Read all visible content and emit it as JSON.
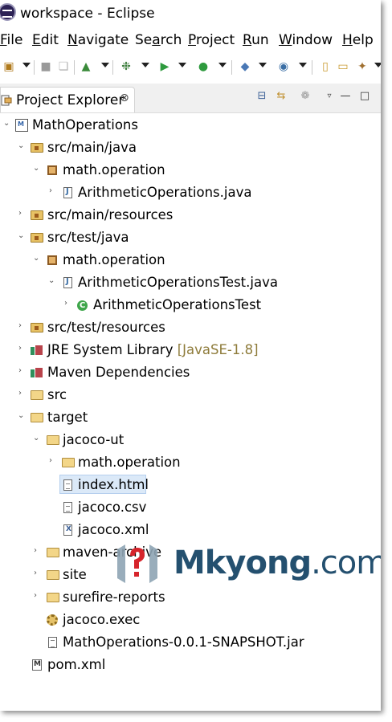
{
  "window": {
    "title": "workspace - Eclipse"
  },
  "menubar": {
    "items": [
      {
        "mnemonic": "F",
        "rest": "ile"
      },
      {
        "mnemonic": "E",
        "rest": "dit"
      },
      {
        "mnemonic": "N",
        "rest": "avigate"
      },
      {
        "prefix": "Se",
        "mnemonic": "a",
        "rest": "rch"
      },
      {
        "mnemonic": "P",
        "rest": "roject"
      },
      {
        "mnemonic": "R",
        "rest": "un"
      },
      {
        "mnemonic": "W",
        "rest": "indow"
      },
      {
        "mnemonic": "H",
        "rest": "elp"
      }
    ]
  },
  "view": {
    "tab_label": "Project Explorer",
    "tab_close": "⊗"
  },
  "tree": [
    {
      "label": "MathOperations",
      "icon": "project-icon",
      "expanded": true
    },
    {
      "label": "src/main/java",
      "icon": "source-folder-icon",
      "expanded": true
    },
    {
      "label": "math.operation",
      "icon": "package-icon",
      "expanded": true
    },
    {
      "label": "ArithmeticOperations.java",
      "icon": "java-file-icon",
      "expanded": false
    },
    {
      "label": "src/main/resources",
      "icon": "source-folder-icon",
      "expanded": false
    },
    {
      "label": "src/test/java",
      "icon": "source-folder-icon",
      "expanded": true
    },
    {
      "label": "math.operation",
      "icon": "package-icon",
      "expanded": true
    },
    {
      "label": "ArithmeticOperationsTest.java",
      "icon": "java-file-icon",
      "expanded": true
    },
    {
      "label": "ArithmeticOperationsTest",
      "icon": "class-icon",
      "expanded": false
    },
    {
      "label": "src/test/resources",
      "icon": "source-folder-icon",
      "expanded": false
    },
    {
      "label": "JRE System Library",
      "decoration": "[JavaSE-1.8]",
      "icon": "library-icon",
      "expanded": false
    },
    {
      "label": "Maven Dependencies",
      "icon": "library-icon",
      "expanded": false
    },
    {
      "label": "src",
      "icon": "folder-icon",
      "expanded": false
    },
    {
      "label": "target",
      "icon": "folder-icon",
      "expanded": true
    },
    {
      "label": "jacoco-ut",
      "icon": "folder-icon",
      "expanded": true
    },
    {
      "label": "math.operation",
      "icon": "folder-icon",
      "expanded": false
    },
    {
      "label": "index.html",
      "icon": "html-file-icon",
      "selected": true
    },
    {
      "label": "jacoco.csv",
      "icon": "file-icon"
    },
    {
      "label": "jacoco.xml",
      "icon": "xml-file-icon"
    },
    {
      "label": "maven-archive",
      "icon": "folder-icon",
      "expanded": false
    },
    {
      "label": "site",
      "icon": "folder-icon",
      "expanded": false
    },
    {
      "label": "surefire-reports",
      "icon": "folder-icon",
      "expanded": false
    },
    {
      "label": "jacoco.exec",
      "icon": "exec-file-icon"
    },
    {
      "label": "MathOperations-0.0.1-SNAPSHOT.jar",
      "icon": "jar-file-icon"
    },
    {
      "label": "pom.xml",
      "icon": "pom-file-icon"
    }
  ],
  "watermark": {
    "name": "Mkyong",
    "dot": ".",
    "tld": "com"
  },
  "colors": {
    "selection": "#dbe9f8",
    "decoration": "#8e7b3a",
    "watermark": "#24506f"
  }
}
